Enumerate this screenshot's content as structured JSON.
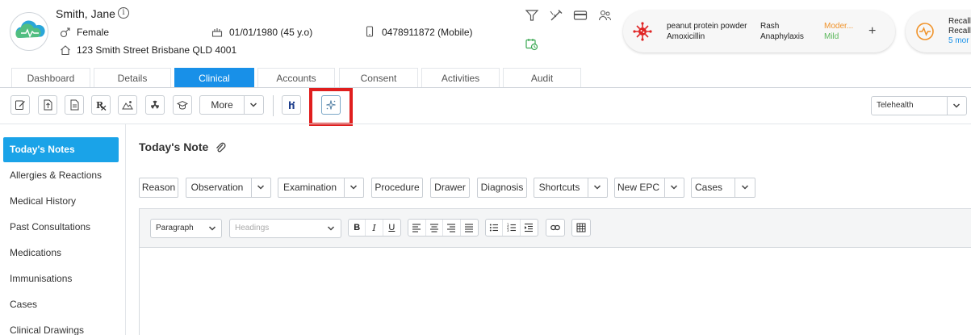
{
  "patient": {
    "name": "Smith, Jane",
    "gender": "Female",
    "dob": "01/01/1980 (45 y.o)",
    "phone": "0478911872 (Mobile)",
    "address": "123 Smith Street Brisbane QLD 4001"
  },
  "header_icons": [
    "filter-icon",
    "syringe-icon",
    "card-icon",
    "people-icon",
    "calendar-clock-icon"
  ],
  "allergies": {
    "items": [
      {
        "substance": "peanut protein powder",
        "reaction": "Rash",
        "severity": "Moder..."
      },
      {
        "substance": "Amoxicillin",
        "reaction": "Anaphylaxis",
        "severity": "Mild"
      }
    ],
    "add_label": "+",
    "colors": {
      "icon": "#e02424",
      "moderate": "#f0932b",
      "mild": "#5cb85c"
    }
  },
  "recalls": {
    "line1": "Recall",
    "line2": "Recall",
    "more": "5 mor",
    "icon_color": "#f0932b",
    "more_color": "#1890e8"
  },
  "tabs": [
    {
      "label": "Dashboard"
    },
    {
      "label": "Details"
    },
    {
      "label": "Clinical",
      "active": true
    },
    {
      "label": "Accounts"
    },
    {
      "label": "Consent"
    },
    {
      "label": "Activities"
    },
    {
      "label": "Audit"
    }
  ],
  "toolbar": {
    "icon_buttons": [
      "note-edit-icon",
      "document-upload-icon",
      "document-icon",
      "prescription-icon",
      "photo-icon",
      "radiation-icon",
      "graduation-cap-icon"
    ],
    "more_label": "More",
    "brand_button": "h",
    "ai_button": "sparkle-icon",
    "telehealth_label": "Telehealth"
  },
  "sidebar": {
    "items": [
      {
        "label": "Today's Notes",
        "active": true
      },
      {
        "label": "Allergies & Reactions"
      },
      {
        "label": "Medical History"
      },
      {
        "label": "Past Consultations"
      },
      {
        "label": "Medications"
      },
      {
        "label": "Immunisations"
      },
      {
        "label": "Cases"
      },
      {
        "label": "Clinical Drawings"
      }
    ]
  },
  "note": {
    "title": "Today's Note",
    "tags": [
      {
        "label": "Reason"
      },
      {
        "label": "Observation",
        "dropdown": true
      },
      {
        "label": "Examination",
        "dropdown": true
      },
      {
        "label": "Procedure"
      },
      {
        "label": "Drawer"
      },
      {
        "label": "Diagnosis"
      },
      {
        "label": "Shortcuts",
        "dropdown": true
      },
      {
        "label": "New EPC",
        "dropdown": true
      },
      {
        "label": "Cases",
        "dropdown": true
      }
    ]
  },
  "editor": {
    "paragraph_label": "Paragraph",
    "headings_placeholder": "Headings",
    "format_buttons": [
      "B",
      "I",
      "U"
    ],
    "align_buttons": [
      "align-left-icon",
      "align-center-icon",
      "align-right-icon",
      "align-justify-icon"
    ],
    "list_buttons": [
      "bullet-list-icon",
      "numbered-list-icon",
      "indent-icon"
    ],
    "link_button": "link-icon",
    "table_button": "table-icon"
  },
  "colors": {
    "accent": "#1890e8",
    "sidebar_active": "#1aa3e8",
    "highlight": "#e01e1e"
  }
}
